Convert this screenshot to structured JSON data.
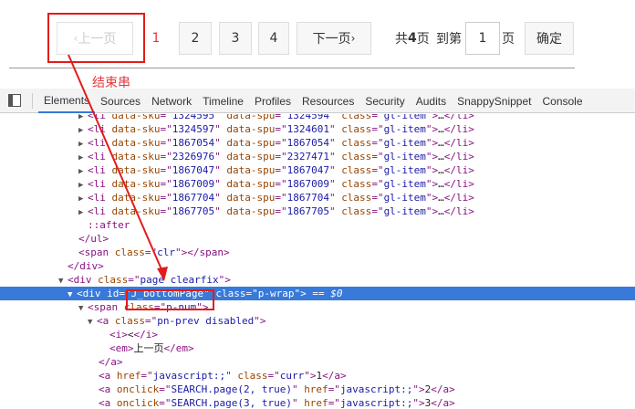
{
  "pager": {
    "prev_label": "上一页",
    "pages": [
      "1",
      "2",
      "3",
      "4"
    ],
    "next_label": "下一页",
    "total_prefix": "共",
    "total_count": "4",
    "total_suffix": "页",
    "goto_label": "到第",
    "goto_value": "1",
    "goto_suffix": "页",
    "confirm_label": "确定"
  },
  "annotation": {
    "label": "结束串",
    "color": "#e31b1b"
  },
  "devtools": {
    "tabs": [
      "Elements",
      "Sources",
      "Network",
      "Timeline",
      "Profiles",
      "Resources",
      "Security",
      "Audits",
      "SnappySnippet",
      "Console"
    ],
    "active_tab": "Elements",
    "selected_color": "#3879d9",
    "li_items": [
      {
        "sku": "1324595",
        "spu": "1324594"
      },
      {
        "sku": "1324597",
        "spu": "1324601"
      },
      {
        "sku": "1867054",
        "spu": "1867054"
      },
      {
        "sku": "2326976",
        "spu": "2327471"
      },
      {
        "sku": "1867047",
        "spu": "1867047"
      },
      {
        "sku": "1867009",
        "spu": "1867009"
      },
      {
        "sku": "1867704",
        "spu": "1867704"
      },
      {
        "sku": "1867705",
        "spu": "1867705"
      }
    ],
    "li_class": "gl-item",
    "after_pseudo": "::after",
    "clr_class": "clr",
    "page_div_class": "page clearfix",
    "bottom_id": "J_bottomPage",
    "bottom_class": "p-wrap",
    "dollar_ref": "== $0",
    "span_class": "p-num",
    "prev_class": "pn-prev disabled",
    "prev_i_text": "<",
    "prev_em_text": "上一页",
    "curr_href": "javascript:;",
    "curr_class": "curr",
    "curr_text": "1",
    "onclick_2": "SEARCH.page(2, true)",
    "text_2": "2",
    "onclick_3": "SEARCH.page(3, true)",
    "text_3": "3"
  }
}
